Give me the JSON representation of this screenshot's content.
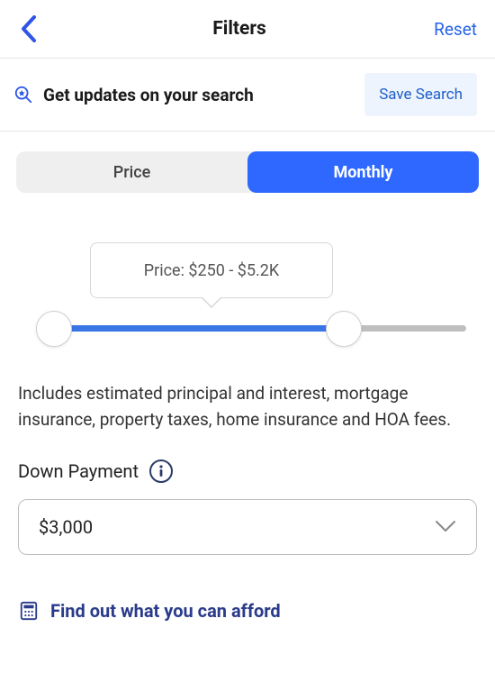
{
  "header": {
    "title": "Filters",
    "reset": "Reset"
  },
  "updates": {
    "text": "Get updates on your search",
    "save": "Save Search"
  },
  "tabs": {
    "price": "Price",
    "monthly": "Monthly"
  },
  "slider": {
    "tooltip": "Price: $250 - $5.2K"
  },
  "disclaimer": "Includes estimated principal and interest, mortgage insurance, property taxes, home insurance and HOA fees.",
  "downPayment": {
    "label": "Down Payment",
    "value": "$3,000"
  },
  "afford": {
    "text": "Find out what you can afford"
  }
}
